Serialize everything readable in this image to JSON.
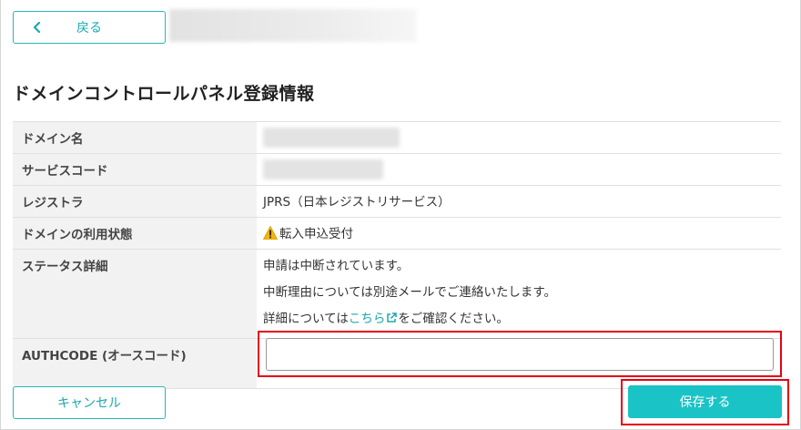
{
  "header": {
    "back_label": "戻る"
  },
  "page": {
    "title": "ドメインコントロールパネル登録情報"
  },
  "rows": {
    "domain_name_label": "ドメイン名",
    "service_code_label": "サービスコード",
    "registrar_label": "レジストラ",
    "registrar_value": "JPRS（日本レジストリサービス）",
    "usage_status_label": "ドメインの利用状態",
    "usage_status_value": "転入申込受付",
    "status_detail_label": "ステータス詳細",
    "status_line1": "申請は中断されています。",
    "status_line2": "中断理由については別途メールでご連絡いたします。",
    "status_line3_pre": "詳細については",
    "status_line3_link": "こちら",
    "status_line3_post": "をご確認ください。",
    "authcode_label": "AUTHCODE (オースコード)",
    "authcode_value": ""
  },
  "footer": {
    "cancel_label": "キャンセル",
    "save_label": "保存する"
  },
  "colors": {
    "accent": "#19c3c6",
    "link": "#1aa9ae",
    "highlight_border": "#e60012",
    "warning": "#f5b400"
  },
  "icons": {
    "back": "chevron-left-icon",
    "warning": "warning-icon",
    "external_link": "external-link-icon"
  }
}
